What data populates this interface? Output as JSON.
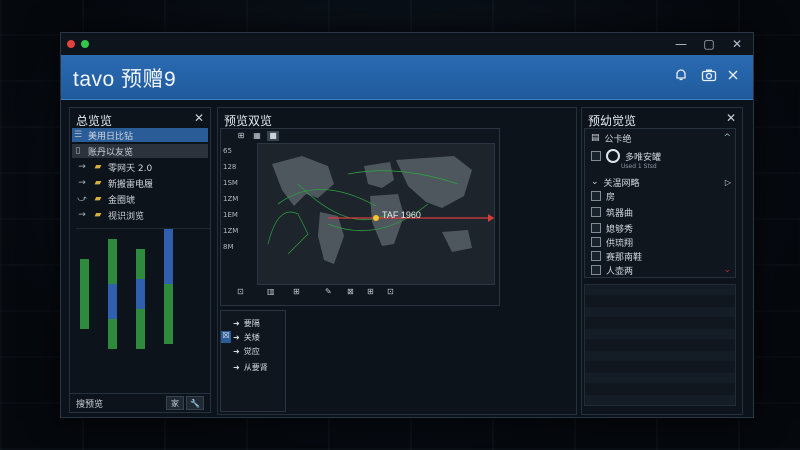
{
  "window": {
    "titlebar_dots": [
      "#e0443a",
      "#30c74b"
    ],
    "controls": {
      "minimize": "—",
      "maximize": "▢",
      "close": "✕"
    }
  },
  "header": {
    "title": "tavo 预赠9",
    "icons": [
      "bell-icon",
      "camera-icon",
      "close-icon"
    ],
    "color": "#2566ac"
  },
  "left_panel": {
    "title": "总览览",
    "items": [
      {
        "label": "美用日比钻",
        "icon": "list-icon",
        "selected": true
      },
      {
        "label": "账丹以友览",
        "icon": "file-icon",
        "selected": false
      },
      {
        "label": "零网天 2.0",
        "icon": "folder-icon",
        "selected": false
      },
      {
        "label": "新搬雷电履",
        "icon": "folder-icon",
        "selected": false
      },
      {
        "label": "金圈琥",
        "icon": "folder-icon",
        "selected": false
      },
      {
        "label": "视识浏览",
        "icon": "folder-icon",
        "selected": false
      }
    ],
    "status_label": "搜预览",
    "status_buttons": [
      "家",
      "🔧"
    ]
  },
  "center_panel": {
    "title": "预览双览",
    "toolbar": [
      "⊞",
      "▦",
      "■"
    ],
    "y_ticks": [
      "65",
      "128",
      "1SM",
      "1ZM",
      "1EM",
      "1ZM",
      "8M"
    ],
    "map_label": "TAF 1960",
    "bottom_tools": [
      "⊡",
      "▥",
      "⊞",
      "✎",
      "⊠",
      "⊞",
      "⊡"
    ],
    "group_items": [
      "要隔",
      "关矮",
      "觉应",
      "从要肾"
    ]
  },
  "right_panel": {
    "title": "预幼觉览",
    "header_item": "公卡绝",
    "radio_label": "多唯安罐",
    "radio_sub": "Used 1 Stsd",
    "items": [
      "关温网略",
      "房",
      "筑器曲",
      "媳够秀",
      "供琉翔",
      "赛那南鞋",
      "人壶两"
    ],
    "accent": "#c0303a"
  },
  "chart_colors": {
    "green": "#2e8a3c",
    "blue": "#2f5fae",
    "red": "#d83a3a",
    "yellow": "#f2c531"
  }
}
